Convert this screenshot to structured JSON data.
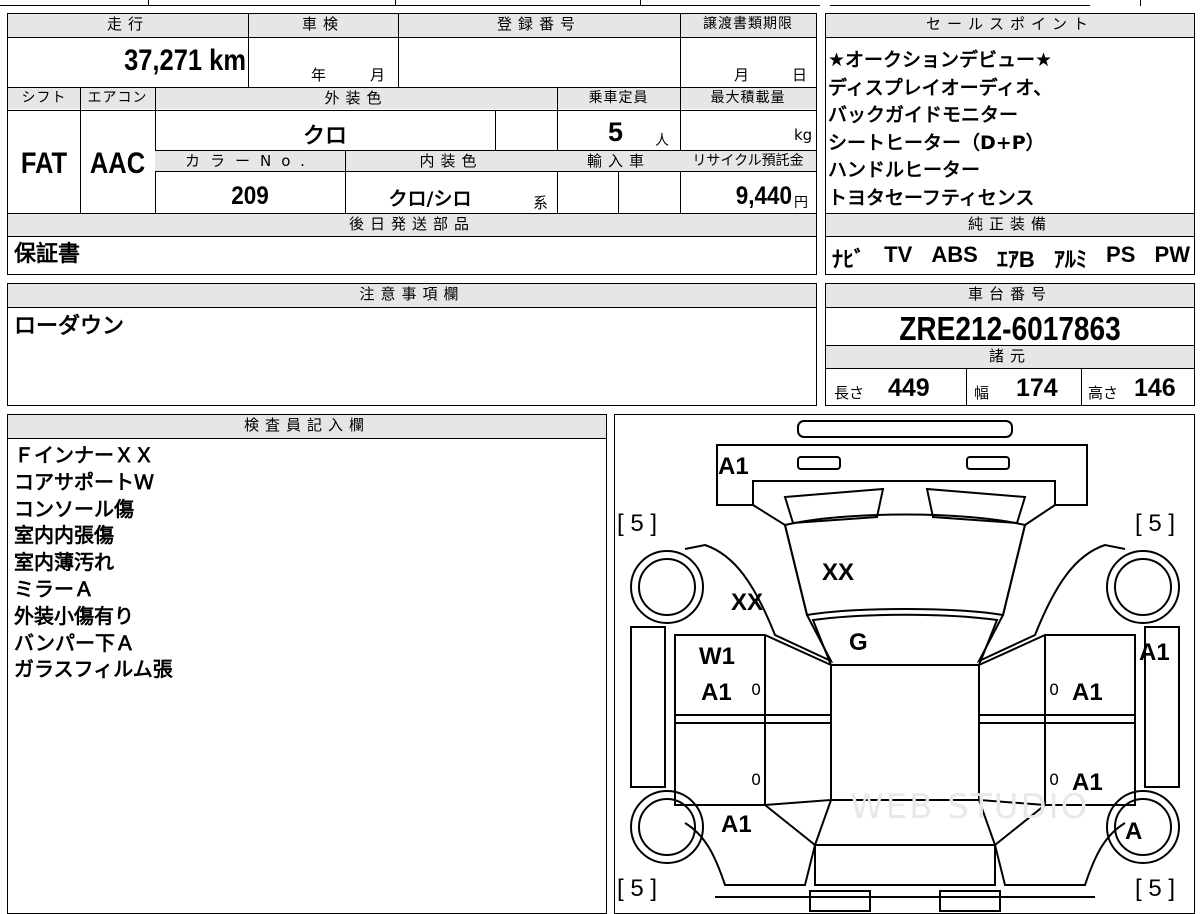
{
  "top_fragment": "",
  "vehicle": {
    "mileage_label": "走行",
    "mileage": "37,271 km",
    "inspection_label": "車検",
    "inspection_year_unit": "年",
    "inspection_month_unit": "月",
    "registration_label": "登録番号",
    "transfer_deadline_label": "譲渡書類期限",
    "transfer_month_unit": "月",
    "transfer_day_unit": "日",
    "shift_label": "シフト",
    "shift": "FAT",
    "aircon_label": "エアコン",
    "aircon": "AAC",
    "exterior_color_label": "外装色",
    "exterior_color": "クロ",
    "capacity_label": "乗車定員",
    "capacity": "5",
    "capacity_unit": "人",
    "max_load_label": "最大積載量",
    "max_load_unit": "kg",
    "color_no_label": "カラーNo.",
    "color_no": "209",
    "interior_color_label": "内装色",
    "interior_color": "クロ/シロ",
    "interior_color_suffix": "系",
    "import_label": "輸入車",
    "recycle_label": "リサイクル預託金",
    "recycle_fee": "9,440",
    "recycle_unit": "円",
    "later_parts_label": "後日発送部品",
    "later_parts": "保証書"
  },
  "sales_points": {
    "label": "セールスポイント",
    "lines": [
      "★オークションデビュー★",
      "ディスプレイオーディオ、",
      "バックガイドモニター",
      "シートヒーター（D+P）",
      "ハンドルヒーター",
      "トヨタセーフティセンス"
    ]
  },
  "equipment": {
    "label": "純正装備",
    "items": [
      "ﾅﾋﾞ",
      "TV",
      "ABS",
      "ｴｱB",
      "ｱﾙﾐ",
      "PS",
      "PW"
    ]
  },
  "caution": {
    "label": "注意事項欄",
    "text": "ローダウン"
  },
  "chassis": {
    "label": "車台番号",
    "number": "ZRE212-6017863"
  },
  "specs": {
    "label": "諸元",
    "length_label": "長さ",
    "length": "449",
    "width_label": "幅",
    "width": "174",
    "height_label": "高さ",
    "height": "146"
  },
  "inspector": {
    "label": "検査員記入欄",
    "notes": [
      "ＦインナーＸＸ",
      "コアサポートＷ",
      "コンソール傷",
      "室内内張傷",
      "室内薄汚れ",
      "ミラーＡ",
      "外装小傷有り",
      "バンパー下Ａ",
      "ガラスフィルム張"
    ]
  },
  "diagram": {
    "marks": {
      "front_bumper": "A1",
      "bonnet": "XX",
      "front_left_fender": "XX",
      "windshield": "G",
      "front_left_door_1": "W1",
      "front_left_door_2": "A1",
      "front_right_door": "A1",
      "rear_right_door": "A1",
      "right_fender": "A1",
      "rear_left_quarter": "A1",
      "rear_right_wheel": "A"
    },
    "tire_front_left": "[ 5 ]",
    "tire_front_right": "[ 5 ]",
    "tire_rear_left": "[ 5 ]",
    "tire_rear_right": "[ 5 ]",
    "zero_1": "0",
    "zero_2": "0",
    "zero_3": "0",
    "zero_4": "0",
    "watermark": "WEB STUDIO"
  }
}
